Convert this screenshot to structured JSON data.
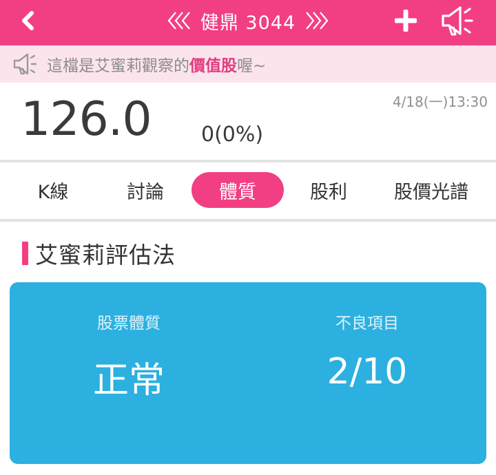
{
  "header": {
    "title": "健鼎 3044",
    "accent": "#f23f84"
  },
  "notice": {
    "prefix": "這檔是艾蜜莉觀察的",
    "highlight": "價值股",
    "suffix": "喔~",
    "icon": "speaker-icon"
  },
  "quote": {
    "price": "126.0",
    "change": "0(0%)",
    "timestamp": "4/18(一)13:30"
  },
  "tabs": [
    {
      "label": "K線",
      "active": false
    },
    {
      "label": "討論",
      "active": false
    },
    {
      "label": "體質",
      "active": true
    },
    {
      "label": "股利",
      "active": false
    },
    {
      "label": "股價光譜",
      "active": false
    }
  ],
  "section": {
    "title": "艾蜜莉評估法"
  },
  "card": {
    "color": "#2cb0e0",
    "left_label": "股票體質",
    "left_value": "正常",
    "right_label": "不良項目",
    "right_value": "2/10"
  }
}
